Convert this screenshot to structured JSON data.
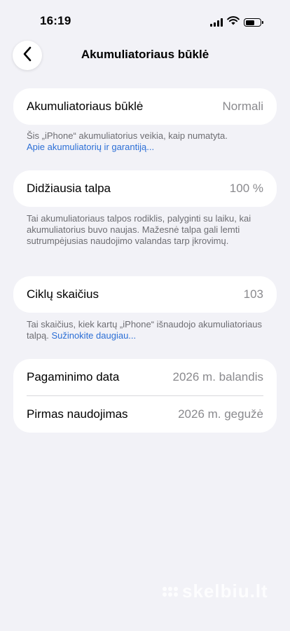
{
  "status_bar": {
    "time": "16:19",
    "icons": [
      "signal-icon",
      "wifi-icon",
      "battery-icon"
    ]
  },
  "nav": {
    "title": "Akumuliatoriaus būklė",
    "back_icon": "chevron-left-icon"
  },
  "health": {
    "label": "Akumuliatoriaus būklė",
    "value": "Normali",
    "footnote_text": "Šis „iPhone“ akumuliatorius veikia, kaip numatyta.",
    "footnote_link": "Apie akumuliatorių ir garantiją..."
  },
  "capacity": {
    "label": "Didžiausia talpa",
    "value": "100 %",
    "footnote_text": "Tai akumuliatoriaus talpos rodiklis, palyginti su laiku, kai akumuliatorius buvo naujas. Mažesnė talpa gali lemti sutrumpėjusias naudojimo valandas tarp įkrovimų."
  },
  "cycles": {
    "label": "Ciklų skaičius",
    "value": "103",
    "footnote_text": "Tai skaičius, kiek kartų „iPhone“ išnaudojo akumuliatoriaus talpą.",
    "footnote_link": "Sužinokite daugiau..."
  },
  "dates": {
    "manufacture_label": "Pagaminimo data",
    "manufacture_value": "2026 m. balandis",
    "first_use_label": "Pirmas naudojimas",
    "first_use_value": "2026 m. gegužė"
  },
  "watermark": "skelbiu.lt",
  "colors": {
    "background": "#f2f2f7",
    "card": "#ffffff",
    "link": "#2c6fd6",
    "secondary_text": "#8a8a8e"
  }
}
